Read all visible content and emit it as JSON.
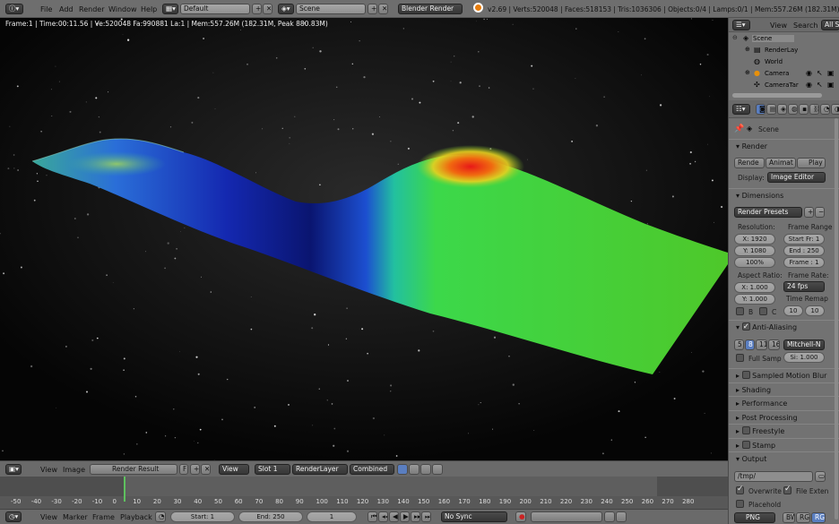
{
  "top_bar": {
    "menus": [
      "File",
      "Add",
      "Render",
      "Window",
      "Help"
    ],
    "screen_layout": "Default",
    "scene": "Scene",
    "engine": "Blender Render",
    "stats": "v2.69 | Verts:520048 | Faces:518153 | Tris:1036306 | Objects:0/4 | Lamps:0/1 | Mem:557.26M (182.31M) | CameraTa"
  },
  "viewport": {
    "info": "Frame:1 | Time:00:11.56 | Ve:520048 Fa:990881 La:1 | Mem:557.26M (182.31M, Peak 880.83M)"
  },
  "outliner": {
    "header": {
      "view": "View",
      "search": "Search",
      "all_scenes": "All S"
    },
    "items": [
      "Scene",
      "RenderLay",
      "World",
      "Camera",
      "CameraTar"
    ]
  },
  "properties": {
    "breadcrumb": "Scene",
    "render": {
      "title": "Render",
      "render_btn": "Rende",
      "anim_btn": "Animat",
      "play_btn": "Play",
      "display_label": "Display:",
      "display_value": "Image Editor"
    },
    "dimensions": {
      "title": "Dimensions",
      "presets": "Render Presets",
      "resolution_label": "Resolution:",
      "res_x": "X: 1920",
      "res_y": "Y: 1080",
      "res_pct": "100%",
      "frame_range_label": "Frame Range",
      "start": "Start Fr: 1",
      "end": "End : 250",
      "frame_step": "Frame : 1",
      "aspect_label": "Aspect Ratio:",
      "aspect_x": "X: 1.000",
      "aspect_y": "Y: 1.000",
      "frame_rate_label": "Frame Rate:",
      "fps": "24 fps",
      "time_remap_label": "Time Remap",
      "remap_old": "10",
      "remap_new": "10",
      "b_label": "B",
      "c_label": "C"
    },
    "anti_aliasing": {
      "title": "Anti-Aliasing",
      "samples": [
        "5",
        "8",
        "11",
        "16"
      ],
      "filter": "Mitchell-N",
      "full_sample": "Full Samp",
      "size": "Si: 1.000"
    },
    "collapsed_panels": [
      "Sampled Motion Blur",
      "Shading",
      "Performance",
      "Post Processing",
      "Freestyle",
      "Stamp"
    ],
    "output": {
      "title": "Output",
      "path": "/tmp/",
      "overwrite": "Overwrite",
      "file_ext": "File Exten",
      "placeholders": "Placehold",
      "format": "PNG",
      "color_modes": [
        "BW",
        "RGB",
        "RGBA"
      ]
    }
  },
  "image_editor_header": {
    "view": "View",
    "image": "Image",
    "image_name": "Render Result",
    "fake_user": "F",
    "view2": "View",
    "slot": "Slot 1",
    "layer": "RenderLayer",
    "pass": "Combined"
  },
  "timeline": {
    "ticks": [
      "-50",
      "-40",
      "-30",
      "-20",
      "-10",
      "0",
      "10",
      "20",
      "30",
      "40",
      "50",
      "60",
      "70",
      "80",
      "90",
      "100",
      "110",
      "120",
      "130",
      "140",
      "150",
      "160",
      "170",
      "180",
      "190",
      "200",
      "210",
      "220",
      "230",
      "240",
      "250",
      "260",
      "270",
      "280"
    ],
    "current_frame": 1
  },
  "timeline_header": {
    "view": "View",
    "marker": "Marker",
    "frame": "Frame",
    "playback": "Playback",
    "start": "Start: 1",
    "end": "End: 250",
    "current": "1",
    "sync": "No Sync"
  }
}
